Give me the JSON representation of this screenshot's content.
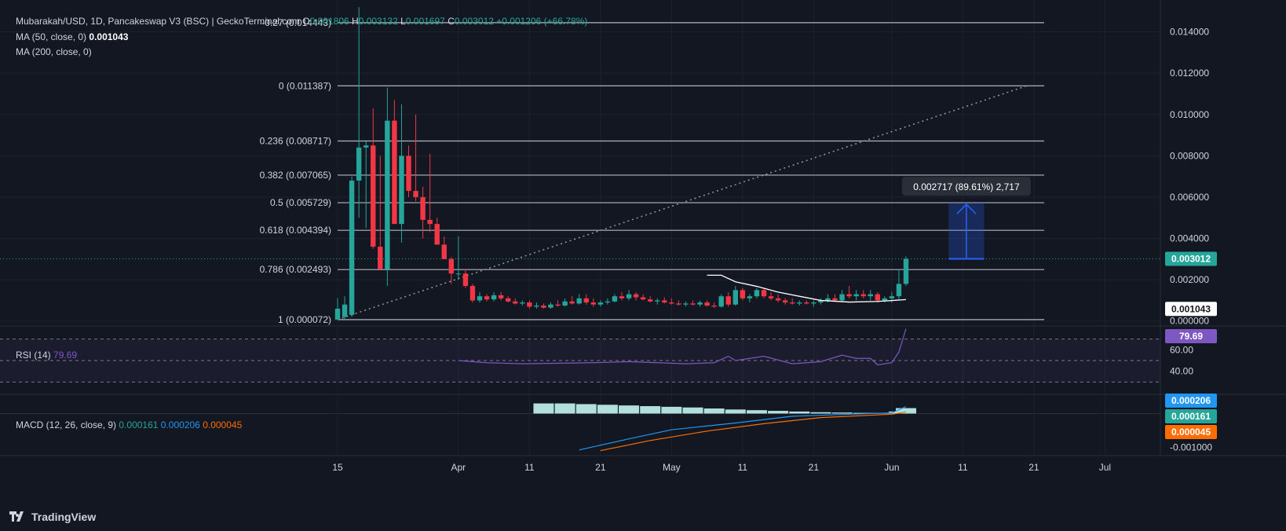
{
  "header": {
    "symbol_line": "Mubarakah/USD, 1D, Pancakeswap V3 (BSC) | GeckoTerminal.com",
    "o_label": "O",
    "o_value": "0.001806",
    "h_label": "H",
    "h_value": "0.003132",
    "l_label": "L",
    "l_value": "0.001697",
    "c_label": "C",
    "c_value": "0.003012",
    "change": "+0.001206 (+66.78%)",
    "ma50_label": "MA (50, close, 0)",
    "ma50_value": "0.001043",
    "ma200_label": "MA (200, close, 0)"
  },
  "colors": {
    "background": "#131722",
    "up": "#26a69a",
    "down": "#f23645",
    "rsi": "#7e57c2",
    "macd": "#2196f3",
    "signal": "#ff6d00",
    "fib": "#b2b5be",
    "measure": "#2962ff"
  },
  "chart_data": {
    "type": "candlestick",
    "title": "Mubarakah/USD, 1D, Pancakeswap V3 (BSC)",
    "price_axis": {
      "ticks": [
        "0.014000",
        "0.012000",
        "0.010000",
        "0.008000",
        "0.006000",
        "0.004000",
        "0.002000",
        "0.000000"
      ],
      "range": [
        -0.0002,
        0.0152
      ]
    },
    "x_axis": {
      "tick_labels": [
        "15",
        "Apr",
        "11",
        "21",
        "May",
        "11",
        "21",
        "Jun",
        "11",
        "21",
        "Jul"
      ],
      "dates": [
        "2025-03-15",
        "2025-04-01",
        "2025-04-11",
        "2025-04-21",
        "2025-05-01",
        "2025-05-11",
        "2025-05-21",
        "2025-06-01",
        "2025-06-11",
        "2025-06-21",
        "2025-07-01"
      ]
    },
    "last_price_label": "0.003012",
    "ma50_label": "0.001043",
    "candles": [
      {
        "date": "2025-03-15",
        "o": 7e-05,
        "h": 0.0011,
        "l": 5e-05,
        "c": 0.0006
      },
      {
        "date": "2025-03-16",
        "o": 0.0002,
        "h": 0.0012,
        "l": 0.0001,
        "c": 0.0008
      },
      {
        "date": "2025-03-17",
        "o": 0.0003,
        "h": 0.007,
        "l": 0.0002,
        "c": 0.0068
      },
      {
        "date": "2025-03-18",
        "o": 0.0068,
        "h": 0.0152,
        "l": 0.005,
        "c": 0.0084
      },
      {
        "date": "2025-03-19",
        "o": 0.0084,
        "h": 0.0087,
        "l": 0.0045,
        "c": 0.0085
      },
      {
        "date": "2025-03-20",
        "o": 0.0085,
        "h": 0.0103,
        "l": 0.0035,
        "c": 0.0036
      },
      {
        "date": "2025-03-21",
        "o": 0.0036,
        "h": 0.008,
        "l": 0.0025,
        "c": 0.0025
      },
      {
        "date": "2025-03-22",
        "o": 0.0025,
        "h": 0.0113,
        "l": 0.0017,
        "c": 0.0097
      },
      {
        "date": "2025-03-23",
        "o": 0.0097,
        "h": 0.0107,
        "l": 0.006,
        "c": 0.0047
      },
      {
        "date": "2025-03-24",
        "o": 0.0047,
        "h": 0.0105,
        "l": 0.0038,
        "c": 0.008
      },
      {
        "date": "2025-03-25",
        "o": 0.008,
        "h": 0.0085,
        "l": 0.006,
        "c": 0.0063
      },
      {
        "date": "2025-03-26",
        "o": 0.0063,
        "h": 0.01,
        "l": 0.0058,
        "c": 0.006
      },
      {
        "date": "2025-03-27",
        "o": 0.006,
        "h": 0.0065,
        "l": 0.004,
        "c": 0.0049
      },
      {
        "date": "2025-03-28",
        "o": 0.0049,
        "h": 0.0081,
        "l": 0.0043,
        "c": 0.0047
      },
      {
        "date": "2025-03-29",
        "o": 0.0047,
        "h": 0.005,
        "l": 0.0038,
        "c": 0.0037
      },
      {
        "date": "2025-03-30",
        "o": 0.0037,
        "h": 0.0041,
        "l": 0.003,
        "c": 0.003
      },
      {
        "date": "2025-03-31",
        "o": 0.003,
        "h": 0.0031,
        "l": 0.0018,
        "c": 0.0023
      },
      {
        "date": "2025-04-01",
        "o": 0.0023,
        "h": 0.0041,
        "l": 0.002,
        "c": 0.0023
      },
      {
        "date": "2025-04-02",
        "o": 0.0023,
        "h": 0.0025,
        "l": 0.0016,
        "c": 0.0017
      },
      {
        "date": "2025-04-03",
        "o": 0.0017,
        "h": 0.0018,
        "l": 0.0009,
        "c": 0.001
      },
      {
        "date": "2025-04-04",
        "o": 0.001,
        "h": 0.0014,
        "l": 0.0009,
        "c": 0.0012
      },
      {
        "date": "2025-04-05",
        "o": 0.0012,
        "h": 0.0013,
        "l": 0.00095,
        "c": 0.00105
      },
      {
        "date": "2025-04-06",
        "o": 0.00105,
        "h": 0.0014,
        "l": 0.00095,
        "c": 0.00125
      },
      {
        "date": "2025-04-07",
        "o": 0.00125,
        "h": 0.0014,
        "l": 0.001,
        "c": 0.0011
      },
      {
        "date": "2025-04-08",
        "o": 0.0011,
        "h": 0.0012,
        "l": 0.0009,
        "c": 0.00095
      },
      {
        "date": "2025-04-09",
        "o": 0.00095,
        "h": 0.0011,
        "l": 0.0008,
        "c": 0.00085
      },
      {
        "date": "2025-04-10",
        "o": 0.00085,
        "h": 0.001,
        "l": 0.00075,
        "c": 0.0009
      },
      {
        "date": "2025-04-11",
        "o": 0.0009,
        "h": 0.001,
        "l": 0.0006,
        "c": 0.0007
      },
      {
        "date": "2025-04-12",
        "o": 0.0007,
        "h": 0.0009,
        "l": 0.0006,
        "c": 0.00075
      },
      {
        "date": "2025-04-13",
        "o": 0.00075,
        "h": 0.00085,
        "l": 0.0006,
        "c": 0.00065
      },
      {
        "date": "2025-04-14",
        "o": 0.00065,
        "h": 0.0009,
        "l": 0.0006,
        "c": 0.0008
      },
      {
        "date": "2025-04-15",
        "o": 0.0008,
        "h": 0.001,
        "l": 0.0007,
        "c": 0.00075
      },
      {
        "date": "2025-04-16",
        "o": 0.00075,
        "h": 0.0011,
        "l": 0.0007,
        "c": 0.00095
      },
      {
        "date": "2025-04-17",
        "o": 0.00095,
        "h": 0.0012,
        "l": 0.0008,
        "c": 0.00085
      },
      {
        "date": "2025-04-18",
        "o": 0.00085,
        "h": 0.0013,
        "l": 0.0008,
        "c": 0.0011
      },
      {
        "date": "2025-04-19",
        "o": 0.0011,
        "h": 0.0013,
        "l": 0.0008,
        "c": 0.0009
      },
      {
        "date": "2025-04-20",
        "o": 0.0009,
        "h": 0.0011,
        "l": 0.0007,
        "c": 0.0008
      },
      {
        "date": "2025-04-21",
        "o": 0.0008,
        "h": 0.001,
        "l": 0.0007,
        "c": 0.0009
      },
      {
        "date": "2025-04-22",
        "o": 0.0009,
        "h": 0.0011,
        "l": 0.0008,
        "c": 0.00095
      },
      {
        "date": "2025-04-23",
        "o": 0.00095,
        "h": 0.0013,
        "l": 0.0009,
        "c": 0.0012
      },
      {
        "date": "2025-04-24",
        "o": 0.0012,
        "h": 0.0014,
        "l": 0.001,
        "c": 0.0011
      },
      {
        "date": "2025-04-25",
        "o": 0.0011,
        "h": 0.0015,
        "l": 0.001,
        "c": 0.0013
      },
      {
        "date": "2025-04-26",
        "o": 0.0013,
        "h": 0.0014,
        "l": 0.001,
        "c": 0.00115
      },
      {
        "date": "2025-04-27",
        "o": 0.00115,
        "h": 0.0013,
        "l": 0.001,
        "c": 0.00105
      },
      {
        "date": "2025-04-28",
        "o": 0.00105,
        "h": 0.0012,
        "l": 0.0009,
        "c": 0.00095
      },
      {
        "date": "2025-04-29",
        "o": 0.00095,
        "h": 0.0011,
        "l": 0.0008,
        "c": 0.001
      },
      {
        "date": "2025-04-30",
        "o": 0.001,
        "h": 0.00115,
        "l": 0.00085,
        "c": 0.0009
      },
      {
        "date": "2025-05-01",
        "o": 0.0009,
        "h": 0.0011,
        "l": 0.0008,
        "c": 0.00085
      },
      {
        "date": "2025-05-02",
        "o": 0.00085,
        "h": 0.001,
        "l": 0.00075,
        "c": 0.0008
      },
      {
        "date": "2025-05-03",
        "o": 0.0008,
        "h": 0.00095,
        "l": 0.0007,
        "c": 0.00085
      },
      {
        "date": "2025-05-04",
        "o": 0.00085,
        "h": 0.001,
        "l": 0.00075,
        "c": 0.0008
      },
      {
        "date": "2025-05-05",
        "o": 0.0008,
        "h": 0.001,
        "l": 0.0007,
        "c": 0.0009
      },
      {
        "date": "2025-05-06",
        "o": 0.0009,
        "h": 0.001,
        "l": 0.0007,
        "c": 0.00075
      },
      {
        "date": "2025-05-07",
        "o": 0.00075,
        "h": 0.0009,
        "l": 0.00065,
        "c": 0.0007
      },
      {
        "date": "2025-05-08",
        "o": 0.0007,
        "h": 0.0013,
        "l": 0.00065,
        "c": 0.0012
      },
      {
        "date": "2025-05-09",
        "o": 0.0012,
        "h": 0.0014,
        "l": 0.0007,
        "c": 0.0008
      },
      {
        "date": "2025-05-10",
        "o": 0.0008,
        "h": 0.0017,
        "l": 0.00075,
        "c": 0.0015
      },
      {
        "date": "2025-05-11",
        "o": 0.0015,
        "h": 0.0016,
        "l": 0.001,
        "c": 0.0011
      },
      {
        "date": "2025-05-12",
        "o": 0.0011,
        "h": 0.0013,
        "l": 0.0009,
        "c": 0.0012
      },
      {
        "date": "2025-05-13",
        "o": 0.0012,
        "h": 0.0016,
        "l": 0.0011,
        "c": 0.0015
      },
      {
        "date": "2025-05-14",
        "o": 0.0015,
        "h": 0.0016,
        "l": 0.0011,
        "c": 0.0012
      },
      {
        "date": "2025-05-15",
        "o": 0.0012,
        "h": 0.0014,
        "l": 0.001,
        "c": 0.0011
      },
      {
        "date": "2025-05-16",
        "o": 0.0011,
        "h": 0.0013,
        "l": 0.0009,
        "c": 0.001
      },
      {
        "date": "2025-05-17",
        "o": 0.001,
        "h": 0.0011,
        "l": 0.0008,
        "c": 0.0009
      },
      {
        "date": "2025-05-18",
        "o": 0.0009,
        "h": 0.0011,
        "l": 0.0008,
        "c": 0.00085
      },
      {
        "date": "2025-05-19",
        "o": 0.00085,
        "h": 0.001,
        "l": 0.00075,
        "c": 0.0009
      },
      {
        "date": "2025-05-20",
        "o": 0.0009,
        "h": 0.001,
        "l": 0.0008,
        "c": 0.00085
      },
      {
        "date": "2025-05-21",
        "o": 0.00085,
        "h": 0.001,
        "l": 0.0007,
        "c": 0.0009
      },
      {
        "date": "2025-05-22",
        "o": 0.0009,
        "h": 0.0011,
        "l": 0.0008,
        "c": 0.001
      },
      {
        "date": "2025-05-23",
        "o": 0.001,
        "h": 0.0013,
        "l": 0.0009,
        "c": 0.0011
      },
      {
        "date": "2025-05-24",
        "o": 0.0011,
        "h": 0.0013,
        "l": 0.00095,
        "c": 0.001
      },
      {
        "date": "2025-05-25",
        "o": 0.001,
        "h": 0.0015,
        "l": 0.00095,
        "c": 0.0013
      },
      {
        "date": "2025-05-26",
        "o": 0.0013,
        "h": 0.0017,
        "l": 0.0011,
        "c": 0.0012
      },
      {
        "date": "2025-05-27",
        "o": 0.0012,
        "h": 0.0015,
        "l": 0.001,
        "c": 0.0013
      },
      {
        "date": "2025-05-28",
        "o": 0.0013,
        "h": 0.0015,
        "l": 0.0011,
        "c": 0.0012
      },
      {
        "date": "2025-05-29",
        "o": 0.0012,
        "h": 0.0015,
        "l": 0.001,
        "c": 0.0013
      },
      {
        "date": "2025-05-30",
        "o": 0.0013,
        "h": 0.0014,
        "l": 0.0009,
        "c": 0.001
      },
      {
        "date": "2025-05-31",
        "o": 0.001,
        "h": 0.0012,
        "l": 0.0009,
        "c": 0.0011
      },
      {
        "date": "2025-06-01",
        "o": 0.0011,
        "h": 0.0014,
        "l": 0.0009,
        "c": 0.0012
      },
      {
        "date": "2025-06-02",
        "o": 0.0012,
        "h": 0.0025,
        "l": 0.001,
        "c": 0.0018
      },
      {
        "date": "2025-06-03",
        "o": 0.0018,
        "h": 0.00313,
        "l": 0.0017,
        "c": 0.00301
      }
    ],
    "ma50": [
      {
        "date": "2025-05-06",
        "v": 0.00222
      },
      {
        "date": "2025-05-08",
        "v": 0.00222
      },
      {
        "date": "2025-05-10",
        "v": 0.0019
      },
      {
        "date": "2025-05-13",
        "v": 0.00168
      },
      {
        "date": "2025-05-16",
        "v": 0.0014
      },
      {
        "date": "2025-05-19",
        "v": 0.0012
      },
      {
        "date": "2025-05-22",
        "v": 0.001
      },
      {
        "date": "2025-05-26",
        "v": 0.00092
      },
      {
        "date": "2025-05-30",
        "v": 0.00095
      },
      {
        "date": "2025-06-03",
        "v": 0.00104
      }
    ],
    "fib_levels": [
      {
        "ratio": "-0.27",
        "label": "-0.27 (0.014443)",
        "price": 0.014443
      },
      {
        "ratio": "0",
        "label": "0 (0.011387)",
        "price": 0.011387
      },
      {
        "ratio": "0.236",
        "label": "0.236 (0.008717)",
        "price": 0.008717
      },
      {
        "ratio": "0.382",
        "label": "0.382 (0.007065)",
        "price": 0.007065
      },
      {
        "ratio": "0.5",
        "label": "0.5 (0.005729)",
        "price": 0.005729
      },
      {
        "ratio": "0.618",
        "label": "0.618 (0.004394)",
        "price": 0.004394
      },
      {
        "ratio": "0.786",
        "label": "0.786 (0.002493)",
        "price": 0.002493
      },
      {
        "ratio": "1",
        "label": "1 (0.000072)",
        "price": 7.2e-05
      }
    ],
    "fib_trend": {
      "from_date": "2025-03-15",
      "from_price": 7.2e-05,
      "to_date": "2025-06-20",
      "to_price": 0.011387
    },
    "measure": {
      "label": "0.002717 (89.61%) 2,717",
      "from_price": 0.003012,
      "to_price": 0.005729,
      "from_date": "2025-06-09",
      "to_date": "2025-06-14"
    },
    "rsi": {
      "label": "RSI (14)",
      "value": "79.69",
      "ticks": [
        "60.00",
        "40.00"
      ],
      "bands": [
        70,
        50,
        30
      ],
      "range": [
        20,
        80
      ],
      "points": [
        {
          "date": "2025-04-01",
          "v": 50
        },
        {
          "date": "2025-04-05",
          "v": 48
        },
        {
          "date": "2025-04-10",
          "v": 47
        },
        {
          "date": "2025-04-20",
          "v": 48
        },
        {
          "date": "2025-04-25",
          "v": 49
        },
        {
          "date": "2025-05-03",
          "v": 47
        },
        {
          "date": "2025-05-07",
          "v": 48
        },
        {
          "date": "2025-05-09",
          "v": 54
        },
        {
          "date": "2025-05-10",
          "v": 50
        },
        {
          "date": "2025-05-14",
          "v": 54
        },
        {
          "date": "2025-05-18",
          "v": 47
        },
        {
          "date": "2025-05-22",
          "v": 49
        },
        {
          "date": "2025-05-25",
          "v": 55
        },
        {
          "date": "2025-05-27",
          "v": 52
        },
        {
          "date": "2025-05-29",
          "v": 52
        },
        {
          "date": "2025-05-30",
          "v": 46
        },
        {
          "date": "2025-06-01",
          "v": 48
        },
        {
          "date": "2025-06-02",
          "v": 58
        },
        {
          "date": "2025-06-03",
          "v": 79.69
        }
      ]
    },
    "macd": {
      "label": "MACD (12, 26, close, 9)",
      "values": [
        "0.000161",
        "0.000206",
        "0.000045"
      ],
      "ticks": [
        "-0.001000"
      ],
      "range": [
        -0.0012,
        0.0005
      ],
      "macd_line": [
        {
          "date": "2025-04-18",
          "v": -0.00108
        },
        {
          "date": "2025-04-25",
          "v": -0.00075
        },
        {
          "date": "2025-05-01",
          "v": -0.00048
        },
        {
          "date": "2025-05-10",
          "v": -0.00028
        },
        {
          "date": "2025-05-18",
          "v": -8e-05
        },
        {
          "date": "2025-05-26",
          "v": -2e-05
        },
        {
          "date": "2025-06-01",
          "v": 2e-05
        },
        {
          "date": "2025-06-03",
          "v": 0.000206
        }
      ],
      "signal_line": [
        {
          "date": "2025-04-21",
          "v": -0.0011
        },
        {
          "date": "2025-04-28",
          "v": -0.0008
        },
        {
          "date": "2025-05-06",
          "v": -0.00052
        },
        {
          "date": "2025-05-14",
          "v": -0.0003
        },
        {
          "date": "2025-05-22",
          "v": -0.00012
        },
        {
          "date": "2025-06-01",
          "v": -2e-05
        },
        {
          "date": "2025-06-03",
          "v": 4.5e-05
        }
      ],
      "histogram": [
        {
          "date": "2025-04-13",
          "v": 0.0003
        },
        {
          "date": "2025-04-16",
          "v": 0.0003
        },
        {
          "date": "2025-04-19",
          "v": 0.00028
        },
        {
          "date": "2025-04-22",
          "v": 0.00026
        },
        {
          "date": "2025-04-25",
          "v": 0.00024
        },
        {
          "date": "2025-04-28",
          "v": 0.00022
        },
        {
          "date": "2025-05-01",
          "v": 0.0002
        },
        {
          "date": "2025-05-04",
          "v": 0.00018
        },
        {
          "date": "2025-05-07",
          "v": 0.00015
        },
        {
          "date": "2025-05-10",
          "v": 0.00012
        },
        {
          "date": "2025-05-13",
          "v": 0.0001
        },
        {
          "date": "2025-05-16",
          "v": 8e-05
        },
        {
          "date": "2025-05-19",
          "v": 6e-05
        },
        {
          "date": "2025-05-22",
          "v": 4e-05
        },
        {
          "date": "2025-05-25",
          "v": 3e-05
        },
        {
          "date": "2025-05-28",
          "v": 2e-05
        },
        {
          "date": "2025-05-31",
          "v": 2e-05
        },
        {
          "date": "2025-06-02",
          "v": 6e-05
        },
        {
          "date": "2025-06-03",
          "v": 0.000161
        }
      ]
    }
  },
  "footer": {
    "brand": "TradingView"
  }
}
